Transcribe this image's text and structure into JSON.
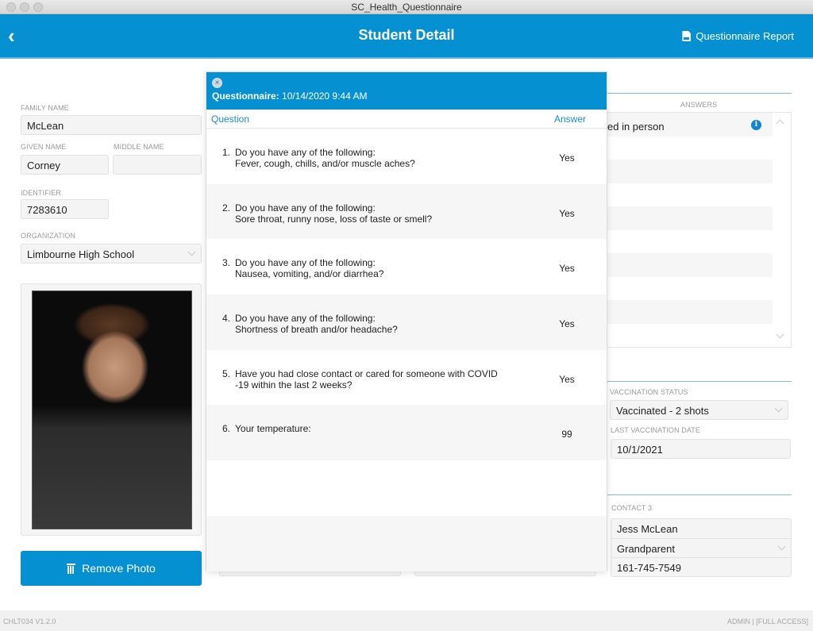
{
  "window": {
    "title": "SC_Health_Questionnaire"
  },
  "nav": {
    "title": "Student Detail",
    "back_icon": "chevron-left-icon",
    "report_label": "Questionnaire Report",
    "report_icon": "pdf-file-icon"
  },
  "student": {
    "family_name_label": "FAMILY NAME",
    "family_name": "McLean",
    "given_name_label": "GIVEN NAME",
    "given_name": "Corney",
    "middle_name_label": "MIDDLE NAME",
    "middle_name": "",
    "identifier_label": "IDENTIFIER",
    "identifier": "7283610",
    "organization_label": "ORGANIZATION",
    "organization": "Limbourne High School",
    "remove_photo_label": "Remove Photo"
  },
  "answers_panel": {
    "header": "ANSWERS",
    "first_value": "ed in person"
  },
  "vaccination": {
    "status_label": "VACCINATION STATUS",
    "status": "Vaccinated - 2 shots",
    "date_label": "LAST VACCINATION DATE",
    "date": "10/1/2021"
  },
  "contact3": {
    "label": "CONTACT 3",
    "name": "Jess McLean",
    "relation": "Grandparent",
    "phone": "161-745-7549"
  },
  "modal": {
    "title_bold": "Questionnaire:",
    "title_value": "10/14/2020 9:44 AM",
    "col_question": "Question",
    "col_answer": "Answer",
    "questions": [
      {
        "num": "1.",
        "text": "Do you have any of the following:\nFever, cough, chills, and/or muscle aches?",
        "answer": "Yes"
      },
      {
        "num": "2.",
        "text": "Do you have any of the following:\nSore throat, runny nose, loss of taste or smell?",
        "answer": "Yes"
      },
      {
        "num": "3.",
        "text": "Do you have any of the following:\nNausea, vomiting, and/or diarrhea?",
        "answer": "Yes"
      },
      {
        "num": "4.",
        "text": "Do you have any of the following:\nShortness of breath and/or headache?",
        "answer": "Yes"
      },
      {
        "num": "5.",
        "text": "Have you had close contact or cared for someone with COVID\n-19 within the last 2 weeks?",
        "answer": "Yes"
      },
      {
        "num": "6.",
        "text": "Your temperature:",
        "answer": "99"
      }
    ]
  },
  "footer": {
    "version": "CHLT034 V1.2.0",
    "access": "ADMIN | [FULL ACCESS]"
  }
}
